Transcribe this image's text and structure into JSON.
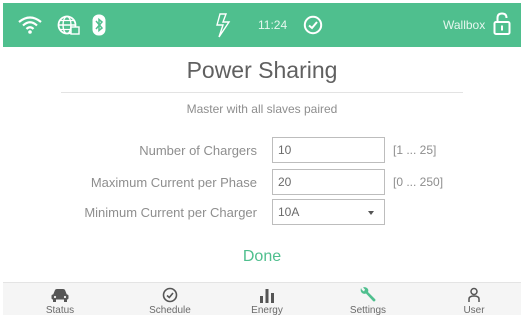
{
  "statusbar": {
    "time": "11:24",
    "device_name": "Wallbox",
    "icons": [
      "wifi-icon",
      "ethernet-globe-icon",
      "bluetooth-icon",
      "charging-plug-icon",
      "check-circle-icon",
      "padlock-icon"
    ]
  },
  "page": {
    "title": "Power Sharing",
    "subtitle": "Master with all slaves paired"
  },
  "form": {
    "chargers": {
      "label": "Number of Chargers",
      "value": "10",
      "range": "[1 ... 25]"
    },
    "max_current": {
      "label": "Maximum Current per Phase",
      "value": "20",
      "range": "[0 ... 250]"
    },
    "min_current": {
      "label": "Minimum Current per Charger",
      "selected": "10A"
    }
  },
  "actions": {
    "done_label": "Done"
  },
  "nav": {
    "items": [
      {
        "label": "Status",
        "icon": "car-icon"
      },
      {
        "label": "Schedule",
        "icon": "clock-icon"
      },
      {
        "label": "Energy",
        "icon": "bar-chart-icon"
      },
      {
        "label": "Settings",
        "icon": "wrench-icon"
      },
      {
        "label": "User",
        "icon": "user-icon"
      }
    ],
    "active": "Settings"
  },
  "colors": {
    "accent": "#4fbf8e",
    "text": "#8e8e8e"
  }
}
